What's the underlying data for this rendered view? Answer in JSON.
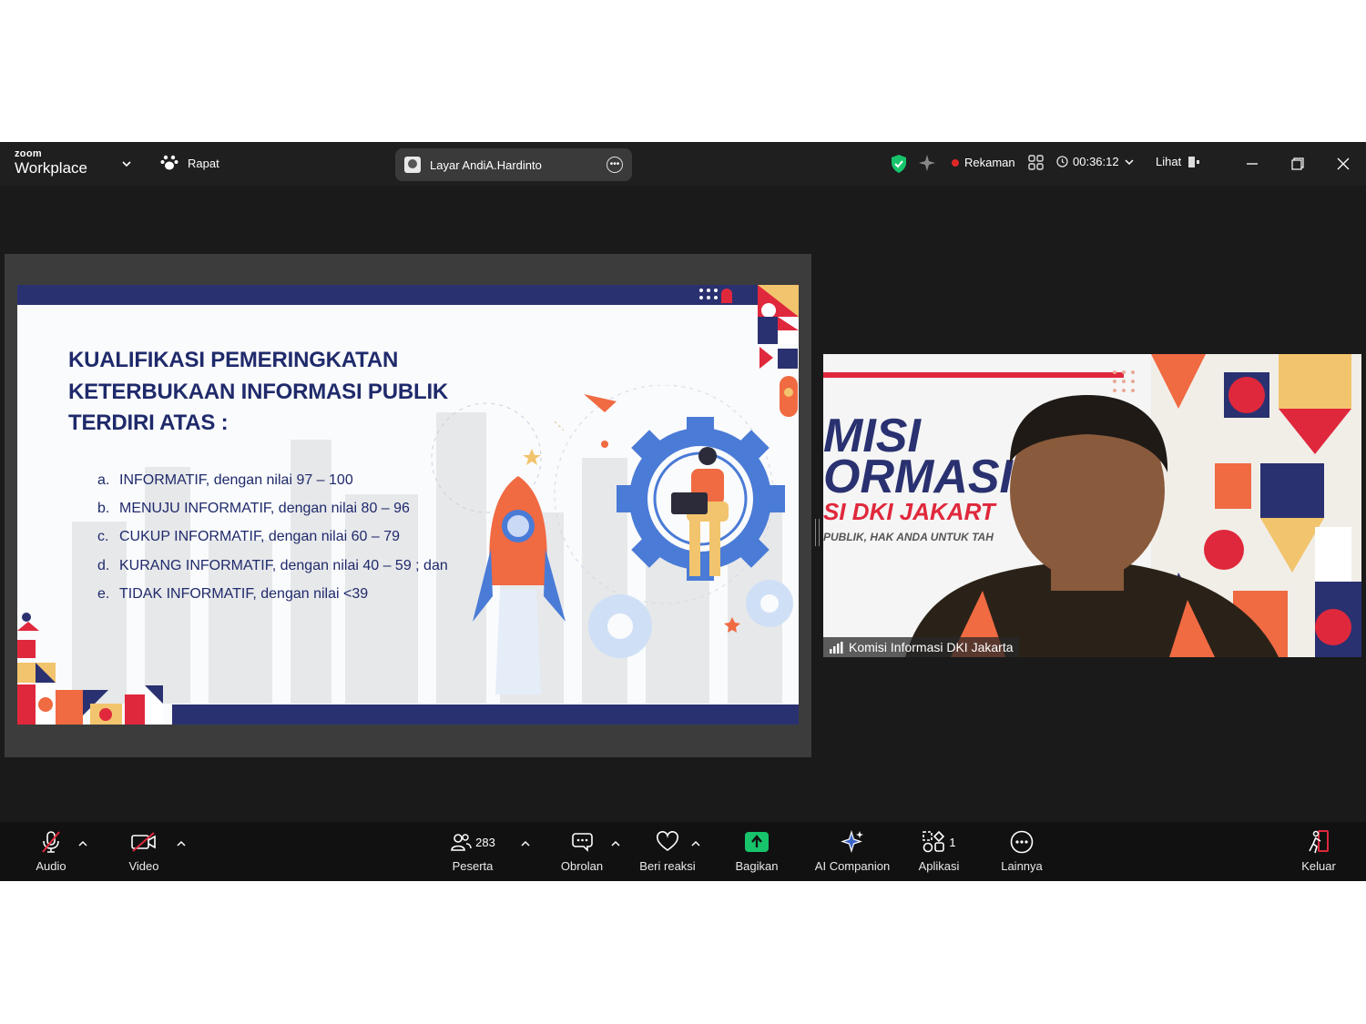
{
  "titlebar": {
    "brand_top": "zoom",
    "brand_bottom": "Workplace",
    "meeting_label": "Rapat",
    "share_pill_label": "Layar AndiA.Hardinto",
    "recording_label": "Rekaman",
    "timer": "00:36:12",
    "view_label": "Lihat"
  },
  "slide": {
    "title": "KUALIFIKASI PEMERINGKATAN KETERBUKAAN INFORMASI PUBLIK TERDIRI ATAS :",
    "items": [
      {
        "marker": "a.",
        "text": "INFORMATIF, dengan nilai 97 – 100"
      },
      {
        "marker": "b.",
        "text": "MENUJU INFORMATIF, dengan nilai 80 – 96"
      },
      {
        "marker": "c.",
        "text": "CUKUP INFORMATIF, dengan nilai 60 – 79"
      },
      {
        "marker": "d.",
        "text": "KURANG INFORMATIF, dengan nilai 40 – 59 ; dan"
      },
      {
        "marker": "e.",
        "text": "TIDAK INFORMATIF, dengan nilai <39"
      }
    ]
  },
  "participant": {
    "name": "Komisi Informasi DKI Jakarta",
    "banner_lines": [
      "MISI",
      "ORMASI",
      "SI DKI JAKART",
      "PUBLIK, HAK ANDA UNTUK TAH"
    ]
  },
  "toolbar": {
    "audio": "Audio",
    "video": "Video",
    "participants": "Peserta",
    "participants_count": "283",
    "chat": "Obrolan",
    "react": "Beri reaksi",
    "share": "Bagikan",
    "ai": "AI Companion",
    "apps": "Aplikasi",
    "apps_count": "1",
    "more": "Lainnya",
    "leave": "Keluar"
  },
  "colors": {
    "slide_navy": "#2a3170",
    "title_blue": "#1f2a6b",
    "share_green": "#17c46b",
    "leave_red": "#e02828",
    "accent_orange": "#f06a42",
    "gear_blue": "#4a7bd6"
  }
}
